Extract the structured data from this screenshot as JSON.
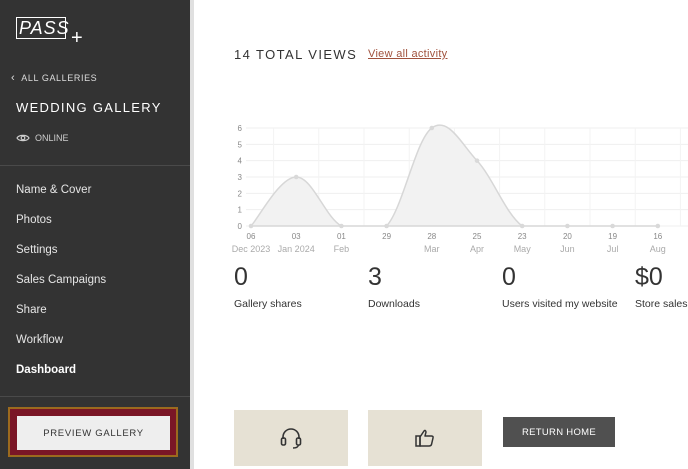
{
  "sidebar": {
    "logo_text": "PASS",
    "logo_plus": "+",
    "back_label": "ALL GALLERIES",
    "gallery_title": "WEDDING GALLERY",
    "status": "ONLINE",
    "nav": [
      {
        "label": "Name & Cover"
      },
      {
        "label": "Photos"
      },
      {
        "label": "Settings"
      },
      {
        "label": "Sales Campaigns"
      },
      {
        "label": "Share"
      },
      {
        "label": "Workflow"
      },
      {
        "label": "Dashboard",
        "active": true
      }
    ],
    "preview_label": "PREVIEW GALLERY"
  },
  "main": {
    "total_views": "14 TOTAL VIEWS",
    "view_activity": "View all activity",
    "stats": [
      {
        "value": "0",
        "label": "Gallery shares"
      },
      {
        "value": "3",
        "label": "Downloads"
      },
      {
        "value": "0",
        "label": "Users visited my website"
      },
      {
        "value": "$0",
        "label": "Store sales"
      }
    ],
    "return_label": "RETURN HOME"
  },
  "colors": {
    "sidebar": "#333333",
    "accent_link": "#a0523d",
    "action_tile": "#e6e1d4",
    "preview_border": "#9c6a1e",
    "preview_bg": "#7a1626"
  },
  "icons": {
    "support": "headset-icon",
    "like": "thumbs-up-icon",
    "views": "eye-icon"
  },
  "chart_data": {
    "type": "area",
    "ylim": [
      0,
      6
    ],
    "yticks": [
      "0",
      "1",
      "2",
      "3",
      "4",
      "5",
      "6"
    ],
    "x_days": [
      "06",
      "03",
      "01",
      "29",
      "28",
      "25",
      "23",
      "20",
      "19",
      "16"
    ],
    "x_months": [
      "Dec 2023",
      "Jan 2024",
      "Feb",
      "",
      "Mar",
      "Apr",
      "May",
      "Jun",
      "Jul",
      "Aug"
    ],
    "values": [
      0,
      3,
      0,
      0,
      6,
      4,
      0,
      0,
      0,
      0
    ],
    "grid": true
  }
}
